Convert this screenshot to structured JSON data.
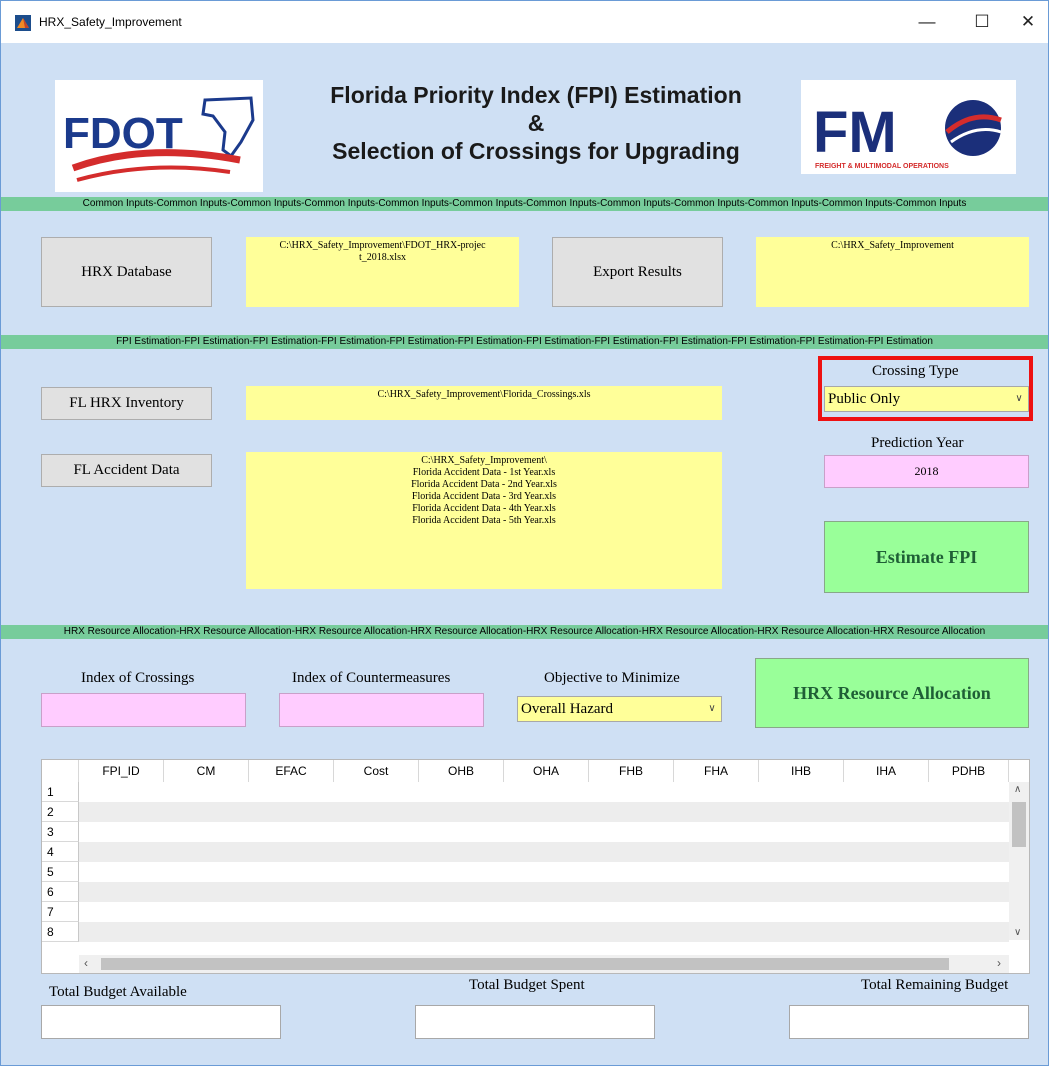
{
  "window": {
    "title": "HRX_Safety_Improvement",
    "minimize": "—",
    "maximize": "☐",
    "close": "✕"
  },
  "header": {
    "title_line1": "Florida Priority Index (FPI) Estimation",
    "title_line2": "&",
    "title_line3": "Selection of Crossings for Upgrading",
    "fdot_logo_text": "FDOT",
    "fmo_logo_text": "FM",
    "fmo_logo_subtext": "FREIGHT & MULTIMODAL OPERATIONS"
  },
  "bands": {
    "common": "Common Inputs-Common Inputs-Common Inputs-Common Inputs-Common Inputs-Common Inputs-Common Inputs-Common Inputs-Common Inputs-Common Inputs-Common Inputs-Common Inputs",
    "fpi": "FPI Estimation-FPI Estimation-FPI Estimation-FPI Estimation-FPI Estimation-FPI Estimation-FPI Estimation-FPI Estimation-FPI Estimation-FPI Estimation-FPI Estimation-FPI Estimation",
    "resource": "HRX Resource Allocation-HRX Resource Allocation-HRX Resource Allocation-HRX Resource Allocation-HRX Resource Allocation-HRX Resource Allocation-HRX Resource Allocation-HRX Resource Allocation"
  },
  "common": {
    "hrx_database_button": "HRX Database",
    "hrx_database_path": "C:\\HRX_Safety_Improvement\\FDOT_HRX-projec\nt_2018.xlsx",
    "export_results_button": "Export Results",
    "export_path": "C:\\HRX_Safety_Improvement"
  },
  "fpi": {
    "inventory_button": "FL HRX Inventory",
    "inventory_path": "C:\\HRX_Safety_Improvement\\Florida_Crossings.xls",
    "accident_button": "FL Accident Data",
    "accident_paths": "C:\\HRX_Safety_Improvement\\\nFlorida Accident Data - 1st Year.xls\nFlorida Accident Data - 2nd Year.xls\nFlorida Accident Data - 3rd Year.xls\nFlorida Accident Data - 4th Year.xls\nFlorida Accident Data - 5th Year.xls",
    "crossing_type_label": "Crossing Type",
    "crossing_type_value": "Public Only",
    "prediction_year_label": "Prediction Year",
    "prediction_year_value": "2018",
    "estimate_button": "Estimate FPI",
    "highlight_color": "#ee1111"
  },
  "resource": {
    "index_crossings_label": "Index of Crossings",
    "index_countermeasures_label": "Index of Countermeasures",
    "objective_label": "Objective to Minimize",
    "objective_value": "Overall Hazard",
    "allocation_button": "HRX Resource Allocation"
  },
  "table": {
    "columns": [
      "FPI_ID",
      "CM",
      "EFAC",
      "Cost",
      "OHB",
      "OHA",
      "FHB",
      "FHA",
      "IHB",
      "IHA",
      "PDHB"
    ],
    "rows": [
      "1",
      "2",
      "3",
      "4",
      "5",
      "6",
      "7",
      "8"
    ]
  },
  "budget": {
    "available_label": "Total Budget Available",
    "spent_label": "Total Budget Spent",
    "remaining_label": "Total Remaining Budget"
  }
}
